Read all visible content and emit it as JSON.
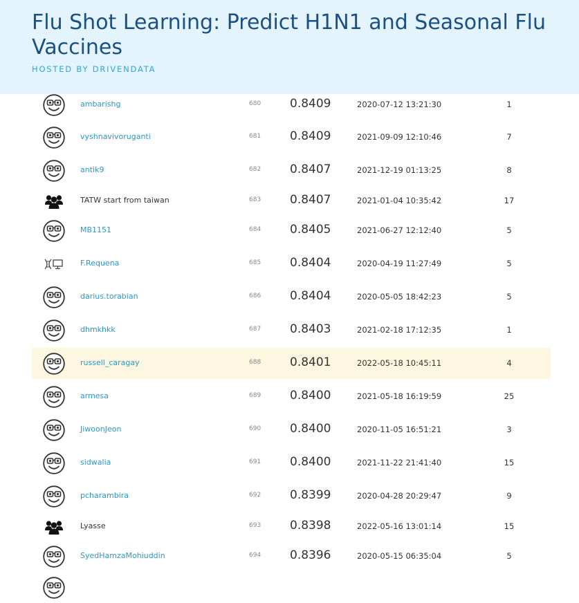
{
  "header": {
    "title": "Flu Shot Learning: Predict H1N1 and Seasonal Flu Vaccines",
    "subtitle": "HOSTED BY DRIVENDATA"
  },
  "rows": [
    {
      "rank": "680",
      "name": "ambarishg",
      "score": "0.8409",
      "date": "2020-07-12 13:21:30",
      "entries": "1",
      "avatar": "smiley-avatar-icon",
      "link": true
    },
    {
      "rank": "681",
      "name": "vyshnavivoruganti",
      "score": "0.8409",
      "date": "2021-09-09 12:10:46",
      "entries": "7",
      "avatar": "smiley-avatar-icon",
      "link": true
    },
    {
      "rank": "682",
      "name": "antik9",
      "score": "0.8407",
      "date": "2021-12-19 01:13:25",
      "entries": "8",
      "avatar": "smiley-avatar-icon",
      "link": true
    },
    {
      "rank": "683",
      "name": "TATW start from taiwan",
      "score": "0.8407",
      "date": "2021-01-04 10:35:42",
      "entries": "17",
      "avatar": "team-icon",
      "link": false
    },
    {
      "rank": "684",
      "name": "MB1151",
      "score": "0.8405",
      "date": "2021-06-27 12:12:40",
      "entries": "5",
      "avatar": "smiley-avatar-icon",
      "link": true
    },
    {
      "rank": "685",
      "name": "F.Requena",
      "score": "0.8404",
      "date": "2020-04-19 11:27:49",
      "entries": "5",
      "avatar": "dna-computer-avatar-icon",
      "link": true
    },
    {
      "rank": "686",
      "name": "darius.torabian",
      "score": "0.8404",
      "date": "2020-05-05 18:42:23",
      "entries": "5",
      "avatar": "smiley-avatar-icon",
      "link": true
    },
    {
      "rank": "687",
      "name": "dhmkhkk",
      "score": "0.8403",
      "date": "2021-02-18 17:12:35",
      "entries": "1",
      "avatar": "smiley-avatar-icon",
      "link": true
    },
    {
      "rank": "688",
      "name": "russell_caragay",
      "score": "0.8401",
      "date": "2022-05-18 10:45:11",
      "entries": "4",
      "avatar": "smiley-avatar-icon",
      "link": true,
      "highlight": true
    },
    {
      "rank": "689",
      "name": "armesa",
      "score": "0.8400",
      "date": "2021-05-18 16:19:59",
      "entries": "25",
      "avatar": "smiley-avatar-icon",
      "link": true
    },
    {
      "rank": "690",
      "name": "JiwoonJeon",
      "score": "0.8400",
      "date": "2020-11-05 16:51:21",
      "entries": "3",
      "avatar": "smiley-avatar-icon",
      "link": true
    },
    {
      "rank": "691",
      "name": "sidwalia",
      "score": "0.8400",
      "date": "2021-11-22 21:41:40",
      "entries": "15",
      "avatar": "smiley-avatar-icon",
      "link": true
    },
    {
      "rank": "692",
      "name": "pcharambira",
      "score": "0.8399",
      "date": "2020-04-28 20:29:47",
      "entries": "9",
      "avatar": "smiley-avatar-icon",
      "link": true
    },
    {
      "rank": "693",
      "name": "Lyasse",
      "score": "0.8398",
      "date": "2022-05-16 13:01:14",
      "entries": "15",
      "avatar": "team-icon",
      "link": false
    },
    {
      "rank": "694",
      "name": "SyedHamzaMohiuddin",
      "score": "0.8396",
      "date": "2020-05-15 06:35:04",
      "entries": "5",
      "avatar": "smiley-avatar-icon",
      "link": true
    },
    {
      "rank": "",
      "name": "",
      "score": "",
      "date": "",
      "entries": "",
      "avatar": "smiley-avatar-icon",
      "link": true
    }
  ]
}
